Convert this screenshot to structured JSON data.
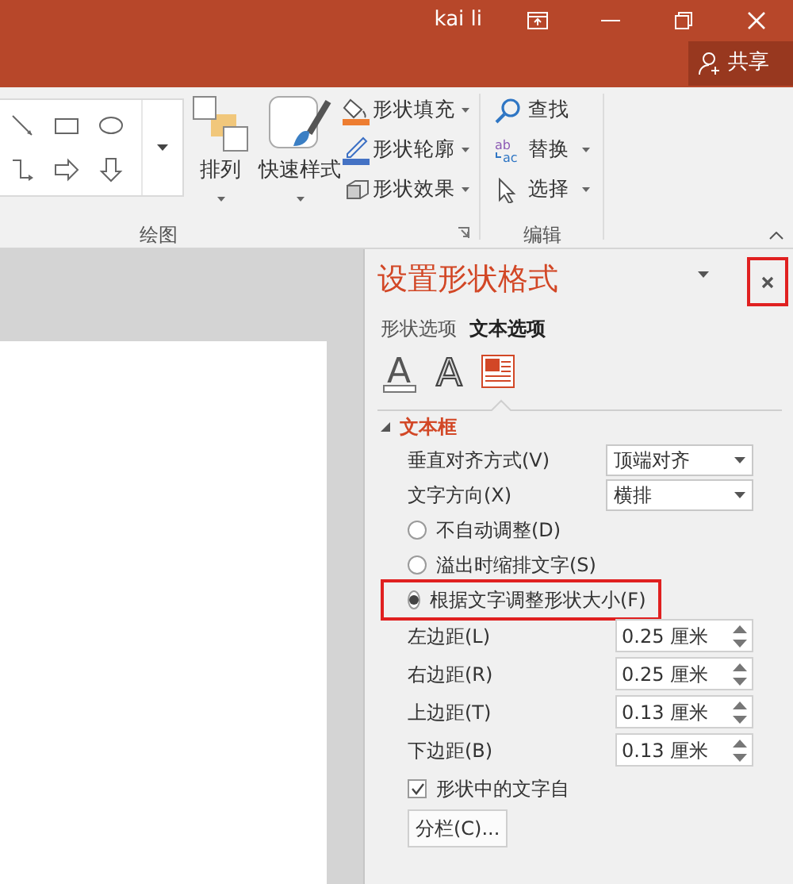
{
  "title_bar": {
    "user": "kai li"
  },
  "share_button": {
    "label": "共享"
  },
  "ribbon": {
    "arrange": "排列",
    "quick_styles": "快速样式",
    "shape_commands": [
      {
        "label": "形状填充",
        "kind": "fill"
      },
      {
        "label": "形状轮廓",
        "kind": "outline"
      },
      {
        "label": "形状效果",
        "kind": "effect"
      }
    ],
    "edit_commands": [
      {
        "label": "查找",
        "kind": "find",
        "has_menu": false
      },
      {
        "label": "替换",
        "kind": "replace",
        "has_menu": true,
        "icon_glyphs": [
          "ab",
          "ac"
        ]
      },
      {
        "label": "选择",
        "kind": "select",
        "has_menu": true
      }
    ],
    "groups": [
      {
        "label": "绘图"
      },
      {
        "label": "编辑"
      }
    ]
  },
  "pane": {
    "title": "设置形状格式",
    "close_highlighted": true,
    "tabs": [
      {
        "label": "形状选项",
        "selected": false
      },
      {
        "label": "文本选项",
        "selected": true
      }
    ],
    "icon_tabs": [
      {
        "kind": "fill",
        "glyph": "A",
        "selected": false
      },
      {
        "kind": "outline",
        "glyph": "A",
        "selected": false
      },
      {
        "kind": "textbox",
        "selected": true
      }
    ],
    "section": {
      "title": "文本框",
      "expanded": true
    },
    "dropdowns": [
      {
        "label": "垂直对齐方式(V)",
        "value": "顶端对齐"
      },
      {
        "label": "文字方向(X)",
        "value": "横排"
      }
    ],
    "radios": [
      {
        "label": "不自动调整(D)",
        "selected": false,
        "highlighted": false
      },
      {
        "label": "溢出时缩排文字(S)",
        "selected": false,
        "highlighted": false
      },
      {
        "label": "根据文字调整形状大小(F)",
        "selected": true,
        "highlighted": true
      }
    ],
    "spinners": [
      {
        "label": "左边距(L)",
        "value": "0.25 厘米"
      },
      {
        "label": "右边距(R)",
        "value": "0.25 厘米"
      },
      {
        "label": "上边距(T)",
        "value": "0.13 厘米"
      },
      {
        "label": "下边距(B)",
        "value": "0.13 厘米"
      }
    ],
    "checkbox": {
      "label": "形状中的文字自",
      "checked": true
    },
    "button": {
      "label": "分栏(C)..."
    }
  }
}
